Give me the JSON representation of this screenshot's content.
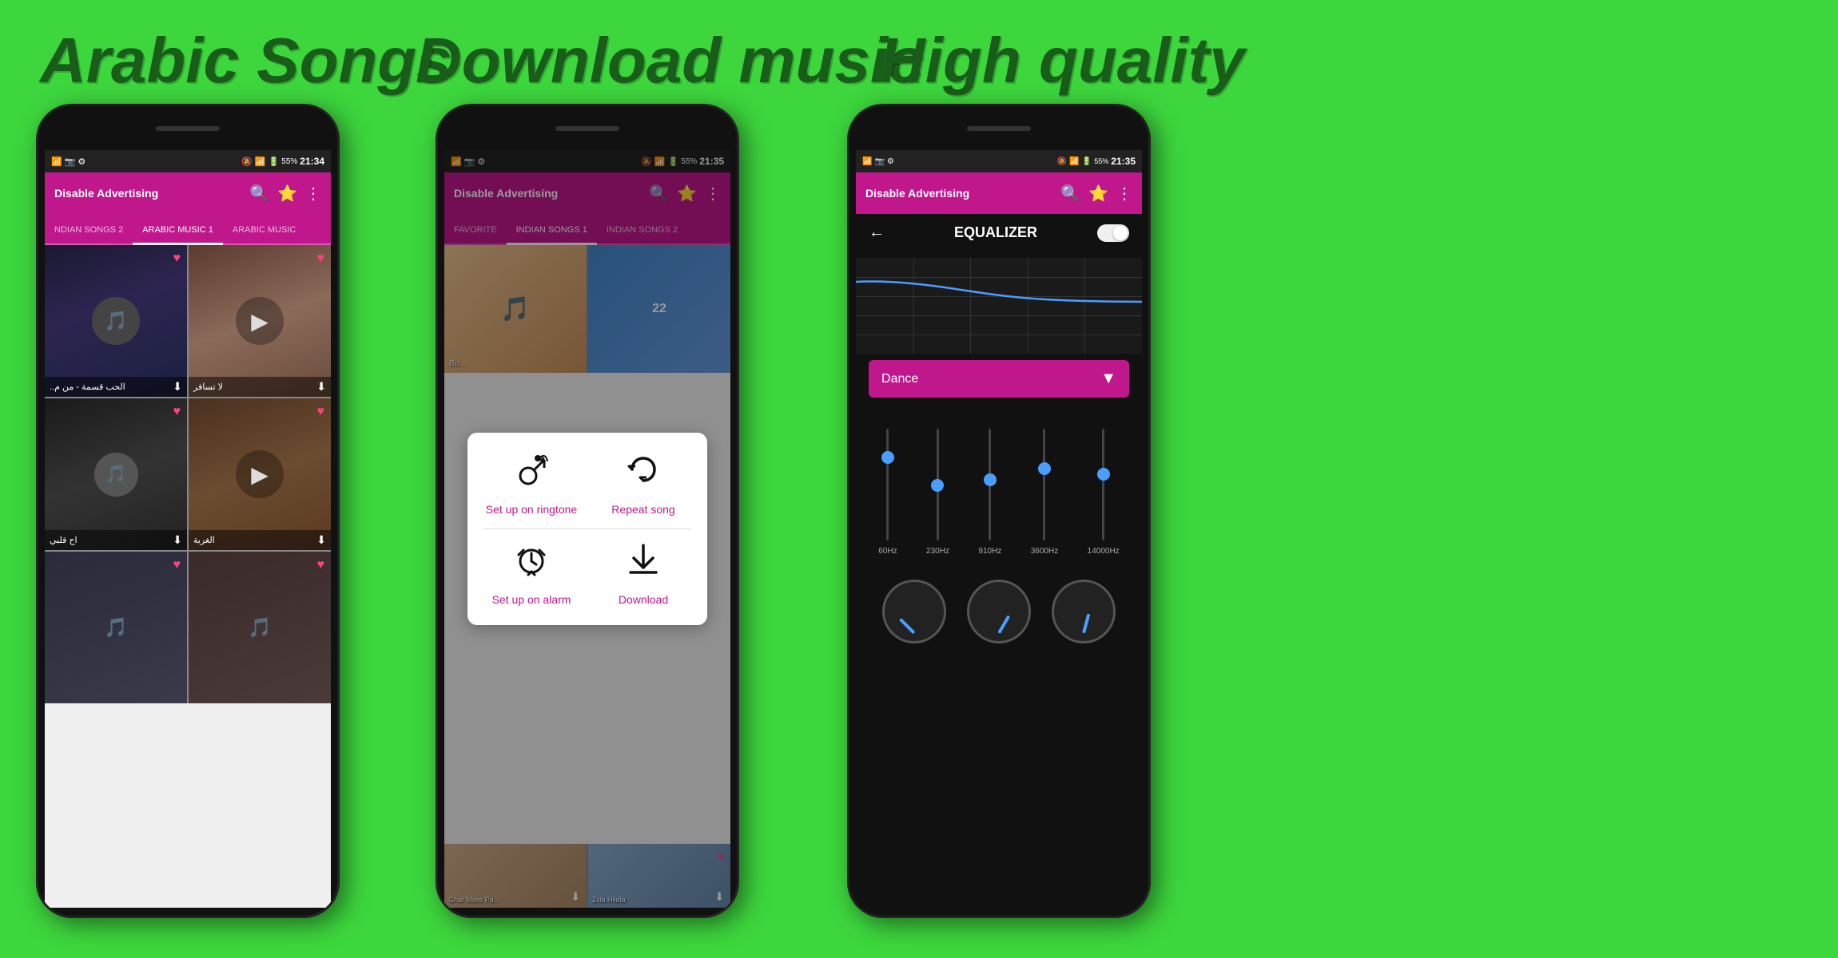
{
  "titles": {
    "arabic": "Arabic Songs",
    "download": "Download music",
    "quality": "High quality"
  },
  "phone1": {
    "appbar_title": "Disable Advertising",
    "tabs": [
      "NDIAN SONGS 2",
      "ARABIC MUSIC 1",
      "ARABIC MUSIC"
    ],
    "active_tab": 1,
    "songs": [
      {
        "title": "الحب قسمة - من م..",
        "has_heart": true,
        "has_play": false,
        "type": "c1"
      },
      {
        "title": "لا تسافر",
        "has_heart": true,
        "has_play": true,
        "type": "c2"
      },
      {
        "title": "اح قلبي",
        "has_heart": true,
        "has_play": false,
        "type": "c3"
      },
      {
        "title": "الغربة",
        "has_heart": true,
        "has_play": true,
        "type": "c4"
      }
    ],
    "time": "21:34",
    "battery": "55%"
  },
  "phone2": {
    "appbar_title": "Disable Advertising",
    "tabs": [
      "FAVORITE",
      "INDIAN SONGS 1",
      "INDIAN SONGS 2"
    ],
    "active_tab": 1,
    "time": "21:35",
    "battery": "55%",
    "popup": {
      "items": [
        {
          "icon": "📞",
          "label": "Set up on ringtone"
        },
        {
          "icon": "🔄",
          "label": "Repeat song"
        },
        {
          "icon": "⏰",
          "label": "Set up on alarm"
        },
        {
          "icon": "⬇",
          "label": "Download"
        }
      ]
    },
    "bg_songs": [
      {
        "label": "Bu...",
        "type": "c1"
      },
      {
        "label": "",
        "type": "c2"
      },
      {
        "label": "Ghar More Pa...",
        "type": "c3"
      },
      {
        "label": "Zilla Hilela",
        "type": "c4"
      }
    ]
  },
  "phone3": {
    "appbar_title": "Disable Advertising",
    "time": "21:35",
    "battery": "55%",
    "eq_title": "EQUALIZER",
    "preset": "Dance",
    "frequencies": [
      "60Hz",
      "230Hz",
      "910Hz",
      "3600Hz",
      "14000Hz"
    ],
    "slider_positions": [
      30,
      55,
      50,
      40,
      45
    ]
  }
}
